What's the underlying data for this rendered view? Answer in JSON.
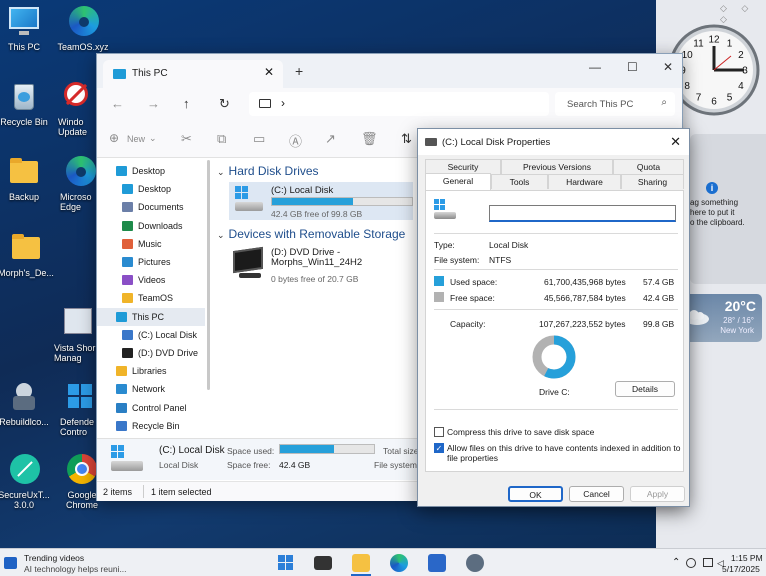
{
  "desktop": {
    "icons": [
      {
        "label": "This PC"
      },
      {
        "label": "TeamOS.xyz"
      },
      {
        "label": "Recycle Bin"
      },
      {
        "label": "Windo\nUpdate"
      },
      {
        "label": "Backup"
      },
      {
        "label": "Microso\nEdge"
      },
      {
        "label": "Morph's_De..."
      },
      {
        "label": "Vista Shor\nManag"
      },
      {
        "label": "Rebuildlco..."
      },
      {
        "label": "Defende\nContro"
      },
      {
        "label": "SecureUxT...\n3.0.0"
      },
      {
        "label": "Google\nChrome"
      }
    ]
  },
  "gadgets": {
    "controls": "◇ ◇ ◇",
    "clock_numbers": [
      "12",
      "1",
      "2",
      "3",
      "4",
      "5",
      "6",
      "7",
      "8",
      "9",
      "10",
      "11"
    ],
    "notes_text": "ag something\nhere to put it\no the clipboard.",
    "weather": {
      "temp": "20°C",
      "range": "28° / 16°",
      "city": "New York"
    }
  },
  "explorer": {
    "tab_title": "This PC",
    "tab_close": "✕",
    "new_tab": "+",
    "window_controls": [
      "—",
      "☐",
      "✕"
    ],
    "nav_buttons": [
      "←",
      "→",
      "↑",
      "↻"
    ],
    "breadcrumb_arrow": "›",
    "search_placeholder": "Search This PC",
    "toolbar": {
      "new_label": "New",
      "new_caret": "⌄",
      "sort_label": "⇅"
    },
    "nav_items": [
      {
        "label": "Desktop",
        "color": "#1f9bd7"
      },
      {
        "label": "Desktop",
        "color": "#1f9bd7"
      },
      {
        "label": "Documents",
        "color": "#6b7fa8"
      },
      {
        "label": "Downloads",
        "color": "#1d8a4a"
      },
      {
        "label": "Music",
        "color": "#e0603a"
      },
      {
        "label": "Pictures",
        "color": "#2a8bd0"
      },
      {
        "label": "Videos",
        "color": "#8a4fc6"
      },
      {
        "label": "TeamOS",
        "color": "#f0b429"
      },
      {
        "label": "This PC",
        "color": "#1f9bd7"
      },
      {
        "label": "(C:) Local Disk",
        "color": "#3a77c9"
      },
      {
        "label": "(D:) DVD Drive",
        "color": "#222222"
      },
      {
        "label": "Libraries",
        "color": "#f0b429"
      },
      {
        "label": "Network",
        "color": "#2a8bd0"
      },
      {
        "label": "Control Panel",
        "color": "#2a7fc4"
      },
      {
        "label": "Recycle Bin",
        "color": "#3a77c9"
      }
    ],
    "groups": {
      "hdd": "Hard Disk Drives",
      "removable": "Devices with Removable Storage"
    },
    "drives": [
      {
        "name": "(C:) Local Disk",
        "free": "42.4 GB free of 99.8 GB",
        "used_fraction": 0.575
      },
      {
        "name": "(D:) DVD Drive -\nMorphs_Win11_24H2",
        "free": "0 bytes free of 20.7 GB"
      }
    ],
    "details": {
      "name": "(C:) Local Disk",
      "type": "Local Disk",
      "space_used_label": "Space used:",
      "space_free_label": "Space free:",
      "space_free_value": "42.4 GB",
      "total_label": "Total size",
      "fs_label": "File system",
      "used_fraction": 0.575
    },
    "status": {
      "items": "2 items",
      "selected": "1 item selected"
    }
  },
  "properties": {
    "title": "(C:) Local Disk Properties",
    "close": "✕",
    "tabs_row1": [
      "Security",
      "Previous Versions",
      "Quota"
    ],
    "tabs_row2": [
      "General",
      "Tools",
      "Hardware",
      "Sharing"
    ],
    "type_label": "Type:",
    "type_value": "Local Disk",
    "fs_label": "File system:",
    "fs_value": "NTFS",
    "used_label": "Used space:",
    "used_bytes": "61,700,435,968 bytes",
    "used_gb": "57.4 GB",
    "free_label": "Free space:",
    "free_bytes": "45,566,787,584 bytes",
    "free_gb": "42.4 GB",
    "capacity_label": "Capacity:",
    "capacity_bytes": "107,267,223,552 bytes",
    "capacity_gb": "99.8 GB",
    "used_fraction": 0.575,
    "drive_label": "Drive C:",
    "details_button": "Details",
    "compress_label": "Compress this drive to save disk space",
    "index_label": "Allow files on this drive to have contents indexed in addition to\nfile properties",
    "index_checked": "✓",
    "ok": "OK",
    "cancel": "Cancel",
    "apply": "Apply",
    "colors": {
      "used": "#26a0da",
      "free": "#b2b2b2"
    }
  },
  "taskbar": {
    "news_title": "Trending videos",
    "news_sub": "AI technology helps reuni...",
    "tray": "⌃",
    "time": "1:15 PM",
    "date": "5/17/2025"
  }
}
